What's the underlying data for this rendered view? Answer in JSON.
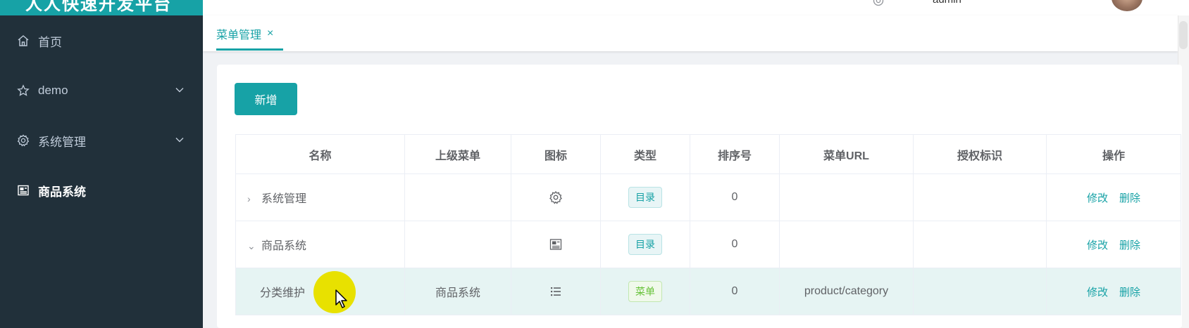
{
  "app": {
    "logo_text": "人人快速开发平台",
    "user_name": "admin"
  },
  "sidebar": {
    "items": [
      {
        "label": "首页",
        "icon": "home-icon"
      },
      {
        "label": "demo",
        "icon": "star-icon"
      },
      {
        "label": "系统管理",
        "icon": "gear-icon"
      },
      {
        "label": "商品系统",
        "icon": "picture-icon"
      }
    ]
  },
  "tabs": [
    {
      "label": "菜单管理",
      "close": "×"
    }
  ],
  "toolbar": {
    "add_label": "新增"
  },
  "table": {
    "columns": [
      "名称",
      "上级菜单",
      "图标",
      "类型",
      "排序号",
      "菜单URL",
      "授权标识",
      "操作"
    ],
    "rows": [
      {
        "name": "系统管理",
        "expander": "›",
        "parent": "",
        "icon": "gear-icon",
        "type": "目录",
        "order": "0",
        "url": "",
        "perms": "",
        "edit": "修改",
        "delete": "删除"
      },
      {
        "name": "商品系统",
        "expander": "⌄",
        "parent": "",
        "icon": "picture-icon",
        "type": "目录",
        "order": "0",
        "url": "",
        "perms": "",
        "edit": "修改",
        "delete": "删除"
      },
      {
        "name": "分类维护",
        "expander": "",
        "parent": "商品系统",
        "icon": "list-icon",
        "type": "菜单",
        "order": "0",
        "url": "product/category",
        "perms": "",
        "edit": "修改",
        "delete": "删除"
      }
    ]
  },
  "colors": {
    "accent": "#17a2a6",
    "sidebar_bg": "#21303a",
    "menu_tag": "#67c23a"
  }
}
